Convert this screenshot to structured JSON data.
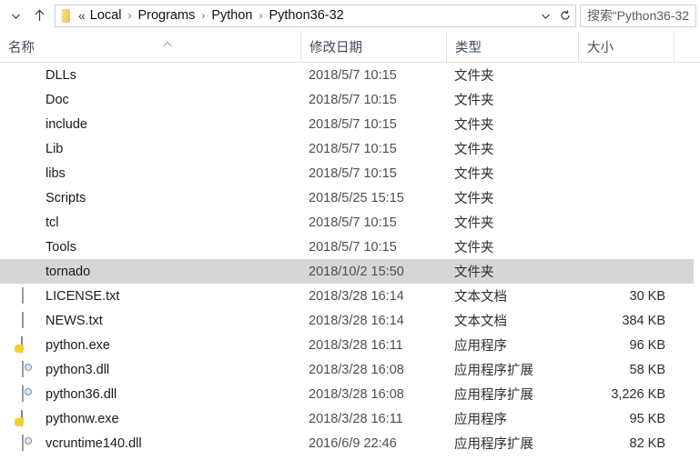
{
  "navbar": {
    "back_dropdown_icon": "chevron-down-icon",
    "up_icon": "up-arrow-icon",
    "address_folder_icon": "folder-icon",
    "path_prefix": "«",
    "breadcrumbs": [
      "Local",
      "Programs",
      "Python",
      "Python36-32"
    ],
    "separator": "›",
    "dropdown_icon": "chevron-down-icon",
    "refresh_icon": "refresh-icon",
    "search": {
      "icon": "search-icon",
      "value": "搜索“Python36-32"
    }
  },
  "columns": [
    {
      "label": "名称",
      "key": "name"
    },
    {
      "label": "修改日期",
      "key": "date"
    },
    {
      "label": "类型",
      "key": "type"
    },
    {
      "label": "大小",
      "key": "size"
    }
  ],
  "sort": {
    "column": "名称",
    "direction": "ascending",
    "caret": "⌃"
  },
  "rows": [
    {
      "name": "DLLs",
      "date": "2018/5/7 10:15",
      "type": "文件夹",
      "size": "",
      "icon": "folder-icon",
      "selected": false
    },
    {
      "name": "Doc",
      "date": "2018/5/7 10:15",
      "type": "文件夹",
      "size": "",
      "icon": "folder-icon",
      "selected": false
    },
    {
      "name": "include",
      "date": "2018/5/7 10:15",
      "type": "文件夹",
      "size": "",
      "icon": "folder-icon",
      "selected": false
    },
    {
      "name": "Lib",
      "date": "2018/5/7 10:15",
      "type": "文件夹",
      "size": "",
      "icon": "folder-icon",
      "selected": false
    },
    {
      "name": "libs",
      "date": "2018/5/7 10:15",
      "type": "文件夹",
      "size": "",
      "icon": "folder-icon",
      "selected": false
    },
    {
      "name": "Scripts",
      "date": "2018/5/25 15:15",
      "type": "文件夹",
      "size": "",
      "icon": "folder-icon",
      "selected": false
    },
    {
      "name": "tcl",
      "date": "2018/5/7 10:15",
      "type": "文件夹",
      "size": "",
      "icon": "folder-icon",
      "selected": false
    },
    {
      "name": "Tools",
      "date": "2018/5/7 10:15",
      "type": "文件夹",
      "size": "",
      "icon": "folder-icon",
      "selected": false
    },
    {
      "name": "tornado",
      "date": "2018/10/2 15:50",
      "type": "文件夹",
      "size": "",
      "icon": "folder-icon",
      "selected": true
    },
    {
      "name": "LICENSE.txt",
      "date": "2018/3/28 16:14",
      "type": "文本文档",
      "size": "30 KB",
      "icon": "text-file-icon",
      "selected": false
    },
    {
      "name": "NEWS.txt",
      "date": "2018/3/28 16:14",
      "type": "文本文档",
      "size": "384 KB",
      "icon": "text-file-icon",
      "selected": false
    },
    {
      "name": "python.exe",
      "date": "2018/3/28 16:11",
      "type": "应用程序",
      "size": "96 KB",
      "icon": "python-exe-icon",
      "selected": false
    },
    {
      "name": "python3.dll",
      "date": "2018/3/28 16:08",
      "type": "应用程序扩展",
      "size": "58 KB",
      "icon": "dll-file-icon",
      "selected": false
    },
    {
      "name": "python36.dll",
      "date": "2018/3/28 16:08",
      "type": "应用程序扩展",
      "size": "3,226 KB",
      "icon": "dll-file-icon",
      "selected": false
    },
    {
      "name": "pythonw.exe",
      "date": "2018/3/28 16:11",
      "type": "应用程序",
      "size": "95 KB",
      "icon": "python-exe-icon",
      "selected": false
    },
    {
      "name": "vcruntime140.dll",
      "date": "2016/6/9 22:46",
      "type": "应用程序扩展",
      "size": "82 KB",
      "icon": "dll-file-icon",
      "selected": false
    }
  ],
  "colors": {
    "selection": "#d6d6d6",
    "folder": "#f2cf6d",
    "header_text": "#3f4b5e",
    "border": "#e3e3e3"
  },
  "column_x": {
    "name": 0,
    "date": 330,
    "type": 490,
    "size": 635,
    "end": 740
  }
}
